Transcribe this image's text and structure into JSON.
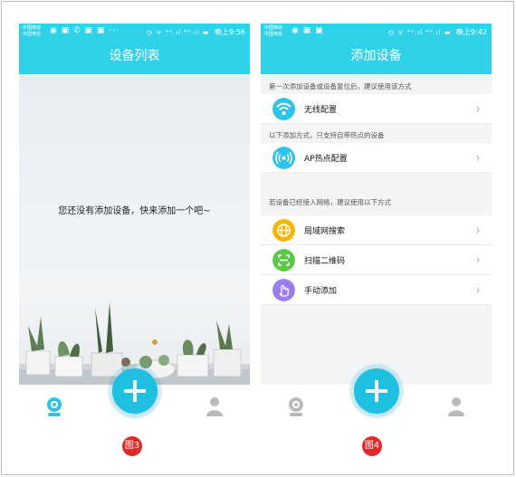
{
  "left_screen": {
    "status": {
      "carrier": "中国移动\n中国电信",
      "icons": "◉ ▣ ✆ ▣ ▣ ···",
      "signal": "◷ ᯤ ⁴ᴳ.ıl ⁴ᴳ.ıl ▬",
      "time": "晚上9:56"
    },
    "title": "设备列表",
    "empty_message": "您还没有添加设备，快来添加一个吧~",
    "nav": {
      "left": "camera-icon",
      "center": "add-icon",
      "right": "user-icon"
    }
  },
  "right_screen": {
    "status": {
      "carrier": "中国移动\n中国电信",
      "icons": "◉ ▣ ▣",
      "signal": "◷ ᯤ ⁴ᴳ.ıl ⁴ᴳ.ıl ▬",
      "time": "晚上9:42"
    },
    "title": "添加设备",
    "hint_first": "第一次添加设备或设备复位后，建议使用该方式",
    "wifi_label": "无线配置",
    "hint_ap": "以下添加方式，只支持自带热点的设备",
    "ap_label": "AP热点配置",
    "hint_network": "若设备已经接入网络，建议使用以下方式",
    "lan_label": "局域网搜索",
    "qr_label": "扫描二维码",
    "manual_label": "手动添加",
    "chevron": "›",
    "colors": {
      "wifi": "#2ec3ea",
      "ap": "#2ec3ea",
      "lan": "#f7b500",
      "qr": "#5cc847",
      "manual": "#9b7cf0"
    }
  },
  "captions": {
    "left": "图3",
    "right": "图4"
  },
  "colors": {
    "header": "#2fd2e8",
    "fab": "#1ebfe0",
    "badge": "#e02828"
  }
}
